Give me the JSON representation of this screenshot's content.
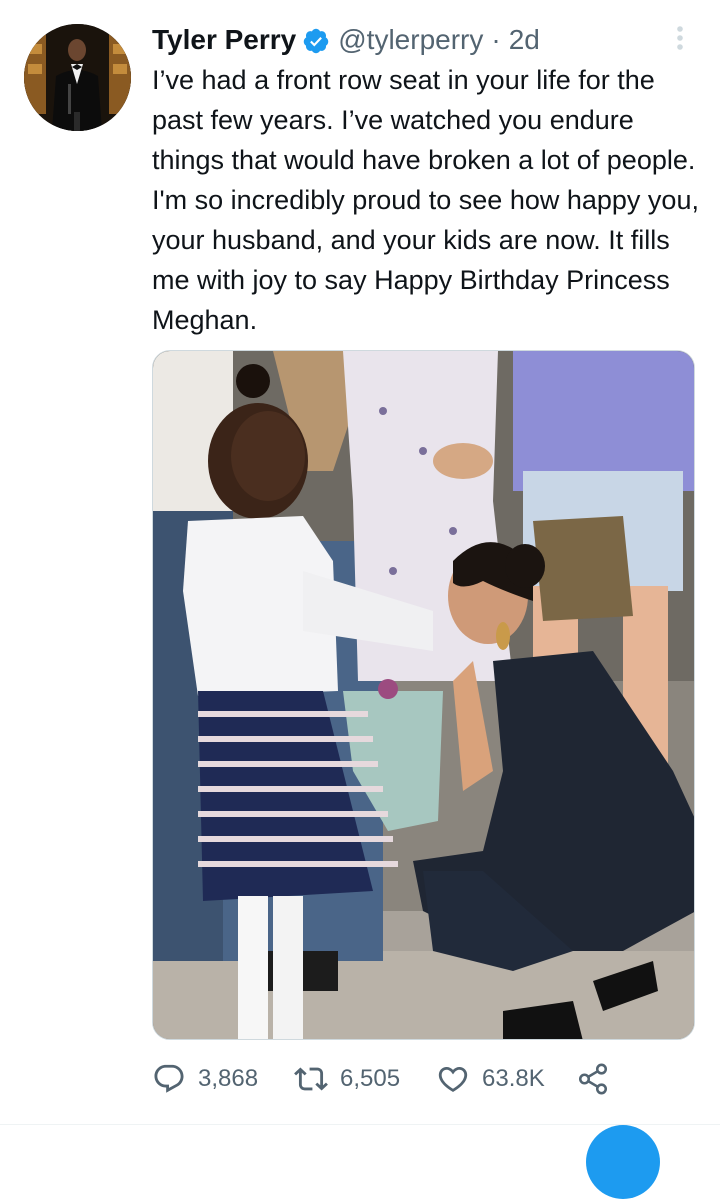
{
  "tweet": {
    "display_name": "Tyler Perry",
    "handle": "@tylerperry",
    "separator": "·",
    "time": "2d",
    "verified": true,
    "text": "I’ve had a front row seat in your life for the past few years. I’ve watched you endure things that would have broken a lot of people. I'm so incredibly proud to see how happy you, your husband, and your kids are now. It fills me with joy to say Happy Birthday Princess Meghan.",
    "actions": {
      "reply": {
        "icon": "reply-icon",
        "count": "3,868"
      },
      "retweet": {
        "icon": "retweet-icon",
        "count": "6,505"
      },
      "like": {
        "icon": "heart-icon",
        "count": "63.8K"
      },
      "share": {
        "icon": "share-icon"
      }
    }
  },
  "colors": {
    "accent": "#1d9bf0",
    "text_primary": "#0f1419",
    "text_secondary": "#536471"
  }
}
